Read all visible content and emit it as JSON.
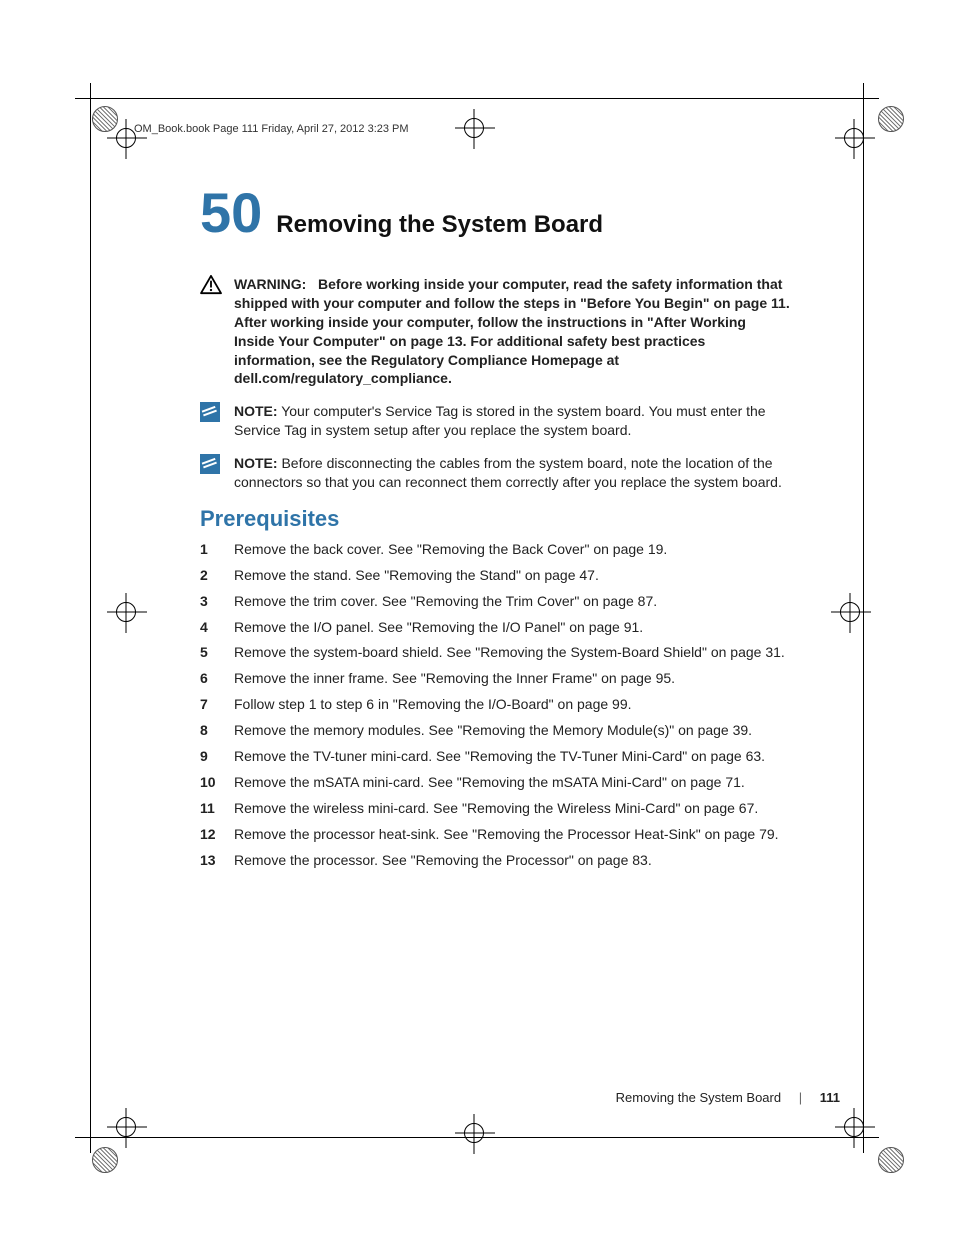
{
  "running_header": "OM_Book.book  Page 111  Friday, April 27, 2012  3:23 PM",
  "chapter": {
    "number": "50",
    "title": "Removing the System Board"
  },
  "warning": {
    "label": "WARNING:",
    "text": "Before working inside your computer, read the safety information that shipped with your computer and follow the steps in \"Before You Begin\" on page 11. After working inside your computer, follow the instructions in \"After Working Inside Your Computer\" on page 13. For additional safety best practices information, see the Regulatory Compliance Homepage at dell.com/regulatory_compliance."
  },
  "notes": [
    {
      "label": "NOTE:",
      "text": "Your computer's Service Tag is stored in the system board. You must enter the Service Tag in system setup after you replace the system board."
    },
    {
      "label": "NOTE:",
      "text": "Before disconnecting the cables from the system board, note the location of the connectors so that you can reconnect them correctly after you replace the system board."
    }
  ],
  "section_heading": "Prerequisites",
  "steps": [
    "Remove the back cover. See \"Removing the Back Cover\" on page 19.",
    "Remove the stand. See \"Removing the Stand\" on page 47.",
    "Remove the trim cover. See \"Removing the Trim Cover\" on page 87.",
    "Remove the I/O panel. See \"Removing the I/O Panel\" on page 91.",
    "Remove the system-board shield. See \"Removing the System-Board Shield\" on page 31.",
    "Remove the inner frame. See \"Removing the Inner Frame\" on page 95.",
    "Follow step 1 to step 6 in \"Removing the I/O-Board\" on page 99.",
    "Remove the memory modules. See \"Removing the Memory Module(s)\" on page 39.",
    "Remove the TV-tuner mini-card. See \"Removing the TV-Tuner Mini-Card\" on page 63.",
    "Remove the mSATA mini-card. See \"Removing the mSATA Mini-Card\" on page 71.",
    "Remove the wireless mini-card. See \"Removing the Wireless Mini-Card\" on page 67.",
    "Remove the processor heat-sink. See \"Removing the Processor Heat-Sink\" on page 79.",
    "Remove the processor. See \"Removing the Processor\" on page 83."
  ],
  "footer": {
    "title": "Removing the System Board",
    "page": "111"
  }
}
